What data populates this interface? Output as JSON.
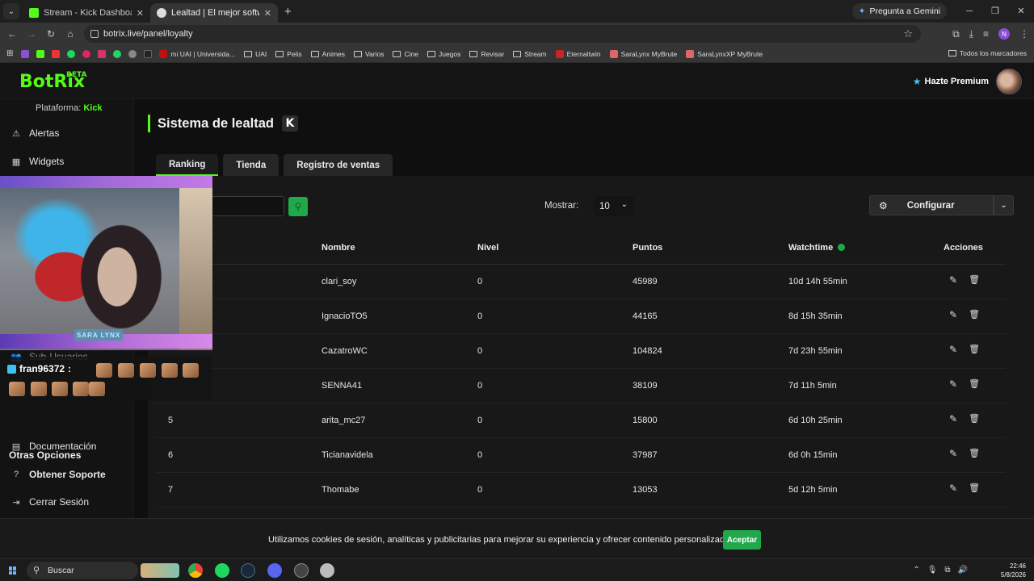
{
  "browser": {
    "tabs": [
      {
        "title": "Stream - Kick Dashboard",
        "active": false
      },
      {
        "title": "Lealtad | El mejor software para",
        "active": true
      }
    ],
    "gemini": "Pregunta a Gemini",
    "url": "botrix.live/panel/loyalty",
    "bookmarks": [
      "mi UAI | Universida...",
      "UAI",
      "Pelis",
      "Animes",
      "Varios",
      "Cine",
      "Juegos",
      "Revisar",
      "Stream",
      "Eternaltwin",
      "SaraLynx MyBrute",
      "SaraLynxXP MyBrute"
    ],
    "all_bookmarks": "Todos los marcadores"
  },
  "site": {
    "logo": "BotRix",
    "logo_badge": "BETA",
    "premium": "Hazte Premium",
    "platform_label": "Plataforma:",
    "platform_value": "Kick",
    "sidebar": {
      "alerts": "Alertas",
      "widgets": "Widgets",
      "subusers": "Sub-Usuarios",
      "other_options": "Otras Opciones",
      "docs": "Documentación",
      "support": "Obtener Soporte",
      "logout": "Cerrar Sesión"
    },
    "page_title": "Sistema de lealtad",
    "kick_badge": "K",
    "tabs": [
      "Ranking",
      "Tienda",
      "Registro de ventas"
    ],
    "show_label": "Mostrar:",
    "show_value": "10",
    "configure": "Configurar",
    "columns": [
      "Nombre",
      "Nivel",
      "Puntos",
      "Watchtime",
      "Acciones"
    ],
    "rows": [
      {
        "rank": "",
        "name": "clari_soy",
        "level": "0",
        "points": "45989",
        "watchtime": "10d 14h 55min"
      },
      {
        "rank": "",
        "name": "IgnacioTO5",
        "level": "0",
        "points": "44165",
        "watchtime": "8d 15h 35min"
      },
      {
        "rank": "",
        "name": "CazatroWC",
        "level": "0",
        "points": "104824",
        "watchtime": "7d 23h 55min"
      },
      {
        "rank": "",
        "name": "SENNA41",
        "level": "0",
        "points": "38109",
        "watchtime": "7d 11h 5min"
      },
      {
        "rank": "5",
        "name": "arita_mc27",
        "level": "0",
        "points": "15800",
        "watchtime": "6d 10h 25min"
      },
      {
        "rank": "6",
        "name": "Ticianavidela",
        "level": "0",
        "points": "37987",
        "watchtime": "6d 0h 15min"
      },
      {
        "rank": "7",
        "name": "Thomabe",
        "level": "0",
        "points": "13053",
        "watchtime": "5d 12h 5min"
      }
    ],
    "cookie_text": "Utilizamos cookies de sesión, analíticas y publicitarias para mejorar su experiencia y ofrecer contenido personalizado.",
    "cookie_accept": "Aceptar"
  },
  "overlay": {
    "cam_name": "SARA LYNX",
    "chat_user": "fran96372"
  },
  "taskbar": {
    "search": "Buscar",
    "time": "22:46",
    "date": "5/8/2026"
  },
  "colors": {
    "accent": "#53fc18",
    "button_green": "#20a84a",
    "premium_star": "#3ec3f0"
  }
}
